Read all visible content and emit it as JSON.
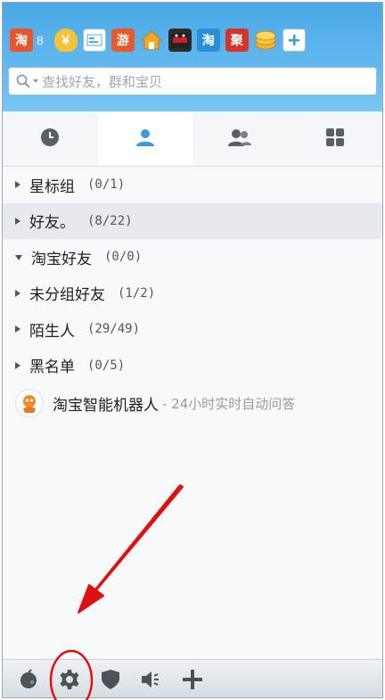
{
  "header": {
    "app_icons": [
      {
        "name": "taobao-icon",
        "glyph": "淘",
        "color": "#e8542b"
      },
      {
        "name": "coin-bag-icon",
        "glyph": "￥",
        "color": "#e8b628"
      },
      {
        "name": "card-icon",
        "glyph": "▤",
        "color": "#6fb0e6"
      },
      {
        "name": "game-icon",
        "glyph": "游",
        "color": "#e7582a"
      },
      {
        "name": "home-icon",
        "glyph": "⌂",
        "color": "#f3a21c"
      },
      {
        "name": "tmall-icon",
        "glyph": "猫",
        "color": "#c8102e"
      },
      {
        "name": "taobao-blue-icon",
        "glyph": "淘",
        "color": "#2b8fd6"
      },
      {
        "name": "ju-icon",
        "glyph": "聚",
        "color": "#d6342b"
      },
      {
        "name": "coins-icon",
        "glyph": "●",
        "color": "#f0b21d"
      },
      {
        "name": "add-icon",
        "glyph": "+",
        "color": "#4ba3e3"
      }
    ],
    "badge_count": "8"
  },
  "search": {
    "placeholder": "查找好友，群和宝贝"
  },
  "tabs": [
    {
      "name": "tab-recent",
      "icon": "clock-icon",
      "active": false
    },
    {
      "name": "tab-contacts",
      "icon": "person-icon",
      "active": true
    },
    {
      "name": "tab-groups",
      "icon": "people-icon",
      "active": false
    },
    {
      "name": "tab-apps",
      "icon": "grid-icon",
      "active": false
    }
  ],
  "groups": [
    {
      "label": "星标组",
      "count": "(0/1)",
      "expanded": false,
      "selected": false
    },
    {
      "label": "好友。",
      "count": "(8/22)",
      "expanded": false,
      "selected": true
    },
    {
      "label": "淘宝好友",
      "count": "(0/0)",
      "expanded": true,
      "selected": false
    },
    {
      "label": "未分组好友",
      "count": "(1/2)",
      "expanded": false,
      "selected": false
    },
    {
      "label": "陌生人",
      "count": "(29/49)",
      "expanded": false,
      "selected": false
    },
    {
      "label": "黑名单",
      "count": "(0/5)",
      "expanded": false,
      "selected": false
    }
  ],
  "robot": {
    "name": "淘宝智能机器人",
    "desc": "- 24小时实时自动问答"
  },
  "bottom_bar": [
    {
      "name": "status-icon"
    },
    {
      "name": "settings-gear-icon"
    },
    {
      "name": "shield-icon"
    },
    {
      "name": "speaker-icon"
    },
    {
      "name": "add-plus-icon"
    }
  ],
  "colors": {
    "header_blue": "#5ab3ec",
    "active_tab": "#3a9be0",
    "annotation_red": "#e01010"
  }
}
